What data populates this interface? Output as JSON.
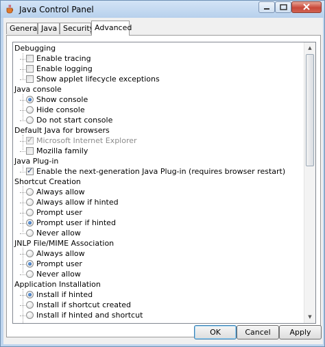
{
  "window": {
    "title": "Java Control Panel"
  },
  "tabs": [
    {
      "label": "General",
      "active": false
    },
    {
      "label": "Java",
      "active": false
    },
    {
      "label": "Security",
      "active": false
    },
    {
      "label": "Advanced",
      "active": true
    }
  ],
  "tree": {
    "debugging": {
      "label": "Debugging",
      "options": [
        {
          "label": "Enable tracing",
          "checked": false
        },
        {
          "label": "Enable logging",
          "checked": false
        },
        {
          "label": "Show applet lifecycle exceptions",
          "checked": false
        }
      ]
    },
    "java_console": {
      "label": "Java console",
      "options": [
        {
          "label": "Show console",
          "selected": true
        },
        {
          "label": "Hide console",
          "selected": false
        },
        {
          "label": "Do not start console",
          "selected": false
        }
      ]
    },
    "default_java": {
      "label": "Default Java for browsers",
      "options": [
        {
          "label": "Microsoft Internet Explorer",
          "checked": true,
          "disabled": true
        },
        {
          "label": "Mozilla family",
          "checked": false
        }
      ]
    },
    "java_plugin": {
      "label": "Java Plug-in",
      "options": [
        {
          "label": "Enable the next-generation Java Plug-in (requires browser restart)",
          "checked": true
        }
      ]
    },
    "shortcut": {
      "label": "Shortcut Creation",
      "options": [
        {
          "label": "Always allow",
          "selected": false
        },
        {
          "label": "Always allow if hinted",
          "selected": false
        },
        {
          "label": "Prompt user",
          "selected": false
        },
        {
          "label": "Prompt user if hinted",
          "selected": true
        },
        {
          "label": "Never allow",
          "selected": false
        }
      ]
    },
    "jnlp": {
      "label": "JNLP File/MIME Association",
      "options": [
        {
          "label": "Always allow",
          "selected": false
        },
        {
          "label": "Prompt user",
          "selected": true
        },
        {
          "label": "Never allow",
          "selected": false
        }
      ]
    },
    "app_install": {
      "label": "Application Installation",
      "options": [
        {
          "label": "Install if hinted",
          "selected": true
        },
        {
          "label": "Install if shortcut created",
          "selected": false
        },
        {
          "label": "Install if hinted and shortcut",
          "selected": false
        }
      ]
    }
  },
  "buttons": {
    "ok": "OK",
    "cancel": "Cancel",
    "apply": "Apply"
  },
  "colors": {
    "titlebar": "#bfd5ee",
    "accent": "#1f4f9a",
    "close": "#c9483a"
  }
}
